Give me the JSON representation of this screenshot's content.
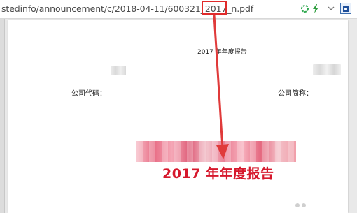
{
  "address_bar": {
    "url": "stedinfo/announcement/c/2018-04-11/600321_2017_n.pdf",
    "icons": [
      "refresh-icon",
      "bolt-icon",
      "chevron-down-icon",
      "extension-icon"
    ]
  },
  "document": {
    "header_title": "2017 年年度报告",
    "company_code_label": "公司代码：",
    "company_name_label": "公司简称：",
    "report_title": "2017 年年度报告"
  },
  "colors": {
    "highlight_red": "#e02b2b",
    "title_red": "#d6182c",
    "arrow_red": "#e03a3a"
  }
}
